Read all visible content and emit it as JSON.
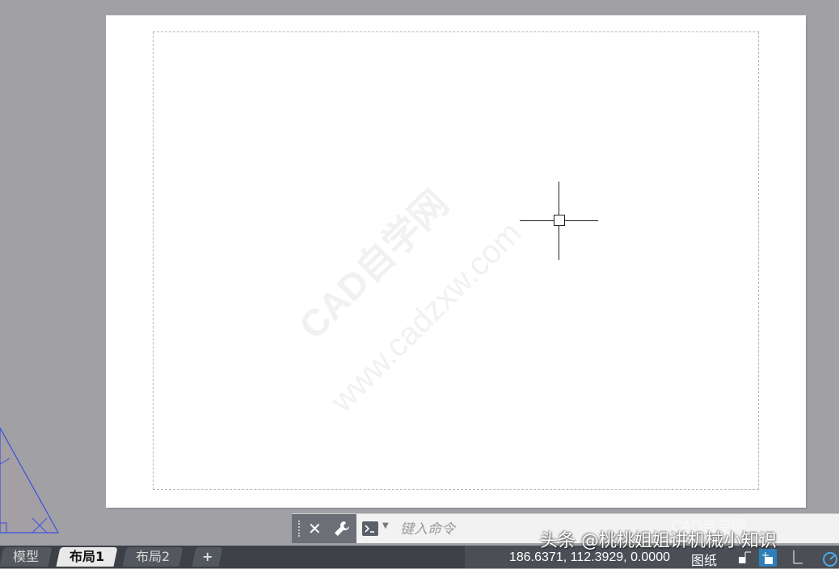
{
  "watermark": {
    "line1": "CAD自学网",
    "line2": "www.cadzxw.com"
  },
  "command": {
    "placeholder": "键入命令"
  },
  "tabs": [
    {
      "label": "模型",
      "active": false
    },
    {
      "label": "布局1",
      "active": true
    },
    {
      "label": "布局2",
      "active": false
    },
    {
      "label": "+"
    }
  ],
  "status": {
    "coordinates": "186.6371, 112.3929, 0.0000",
    "space": "图纸"
  },
  "overlay": {
    "caption": "头条 @桃桃姐姐讲机械小知识",
    "mark": "CAD自学网"
  },
  "colors": {
    "triangle": "#3a50e0",
    "active_toggle": "#2c7fb8"
  },
  "icons": [
    "close-icon",
    "wrench-icon",
    "command-prompt-icon",
    "grid-icon",
    "snap-icon",
    "ortho-icon",
    "polar-icon"
  ]
}
